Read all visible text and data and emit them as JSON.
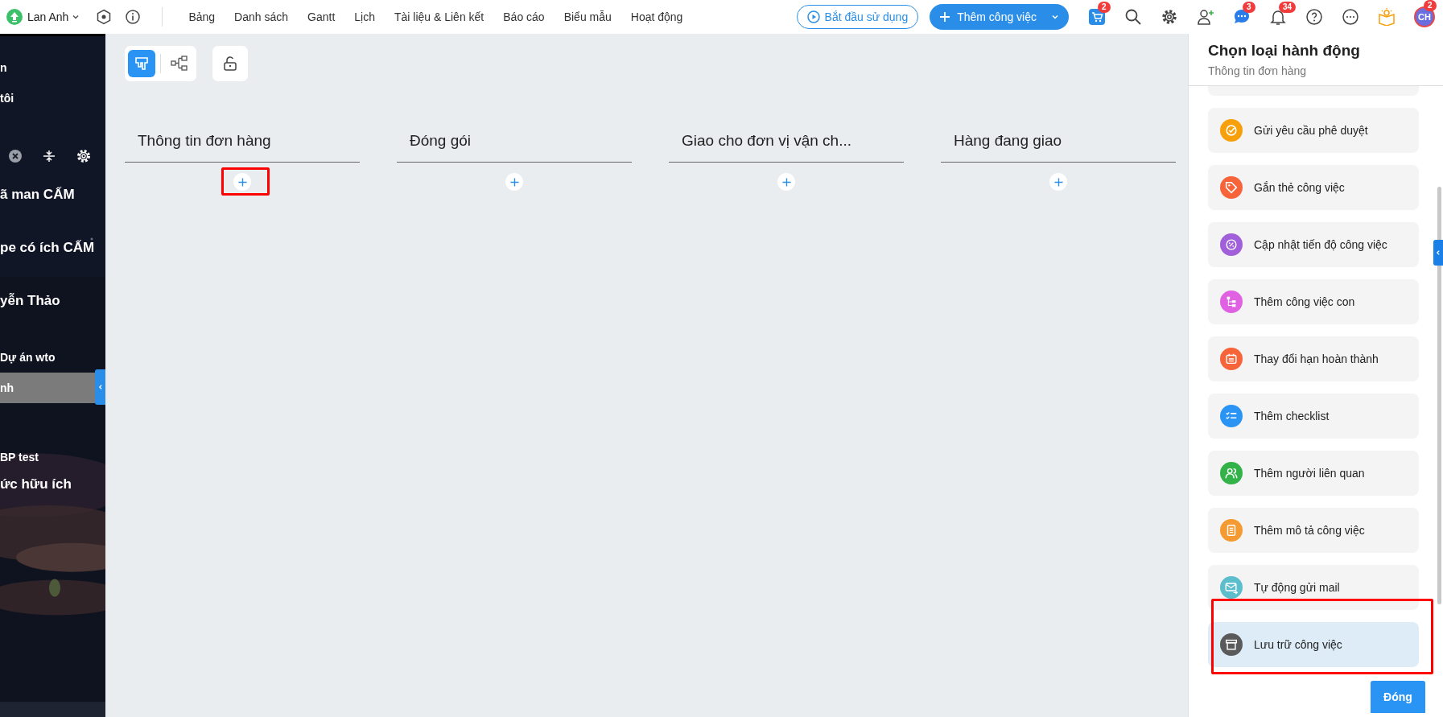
{
  "app_bar": {
    "workspace": "Lan Anh",
    "nav": [
      {
        "label": "Bảng"
      },
      {
        "label": "Danh sách"
      },
      {
        "label": "Gantt"
      },
      {
        "label": "Lịch"
      },
      {
        "label": "Tài liệu & Liên kết"
      },
      {
        "label": "Báo cáo"
      },
      {
        "label": "Biểu mẫu"
      },
      {
        "label": "Hoạt động"
      }
    ],
    "start_button": "Bắt đầu sử dụng",
    "add_button": "Thêm công việc",
    "cart_badge": "2",
    "chat_badge": "3",
    "bell_badge": "34",
    "avatar": "CH",
    "avatar_badge": "2"
  },
  "sidebar": {
    "items": [
      {
        "label": "n",
        "kind": "item",
        "selected": false
      },
      {
        "label": "tôi",
        "kind": "item",
        "selected": false
      },
      {
        "kind": "tools"
      },
      {
        "label": "ã man CẤM",
        "kind": "group",
        "selected": false
      },
      {
        "label": "pe có ích CẤM",
        "kind": "group",
        "selected": false
      },
      {
        "label": "yễn Thảo",
        "kind": "group",
        "selected": false
      },
      {
        "label": "Dự án wto",
        "kind": "item",
        "selected": false
      },
      {
        "label": "nh",
        "kind": "item",
        "selected": true
      },
      {
        "kind": "spacer"
      },
      {
        "label": "BP test",
        "kind": "item",
        "selected": false
      },
      {
        "label": "ức hữu ích",
        "kind": "group",
        "selected": false
      }
    ]
  },
  "board": {
    "columns": [
      {
        "title": "Thông tin đơn hàng",
        "highlighted": true
      },
      {
        "title": "Đóng gói",
        "highlighted": false
      },
      {
        "title": "Giao cho đơn vị vận ch...",
        "highlighted": false
      },
      {
        "title": "Hàng đang giao",
        "highlighted": false
      }
    ]
  },
  "panel": {
    "title": "Chọn loại hành động",
    "subtitle": "Thông tin đơn hàng",
    "actions": [
      {
        "label": "Gửi yêu cầu phê duyệt",
        "kind": "approval",
        "color": "#f7a00c",
        "selected": false,
        "highlighted": false
      },
      {
        "label": "Gắn thẻ công việc",
        "kind": "tag",
        "color": "#f7643a",
        "selected": false,
        "highlighted": false
      },
      {
        "label": "Cập nhật tiến độ công việc",
        "kind": "progress",
        "color": "#a15fd9",
        "selected": false,
        "highlighted": false
      },
      {
        "label": "Thêm công việc con",
        "kind": "subtask",
        "color": "#e062e3",
        "selected": false,
        "highlighted": false
      },
      {
        "label": "Thay đổi hạn hoàn thành",
        "kind": "deadline",
        "color": "#f7643a",
        "selected": false,
        "highlighted": false
      },
      {
        "label": "Thêm checklist",
        "kind": "checklist",
        "color": "#2a94f4",
        "selected": false,
        "highlighted": false
      },
      {
        "label": "Thêm người liên quan",
        "kind": "people",
        "color": "#34b24a",
        "selected": false,
        "highlighted": false
      },
      {
        "label": "Thêm mô tả công việc",
        "kind": "description",
        "color": "#f49a30",
        "selected": false,
        "highlighted": false
      },
      {
        "label": "Tự động gửi mail",
        "kind": "mail",
        "color": "#5cbdcc",
        "selected": false,
        "highlighted": false
      },
      {
        "label": "Lưu trữ công việc",
        "kind": "archive",
        "color": "#5a5a5a",
        "selected": true,
        "highlighted": true
      }
    ],
    "close_button": "Đóng"
  }
}
